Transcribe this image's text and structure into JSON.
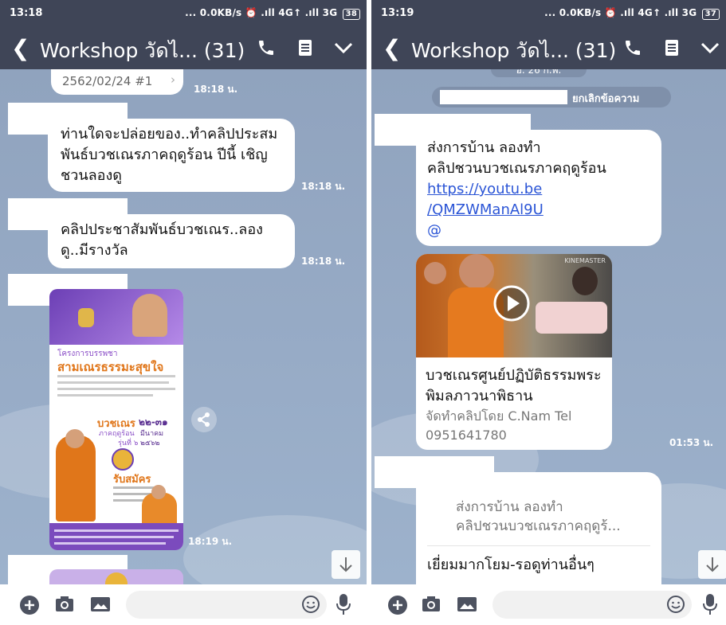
{
  "left": {
    "status": {
      "time": "13:18",
      "right": "... 0.0KB/s ⏰ .ıll 4G↑ .ıll 3G",
      "battery": "38"
    },
    "header": {
      "title": "Workshop วัดไ... (31)"
    },
    "messages": {
      "top_pill": "2562/02/24 #1",
      "top_time": "18:18 น.",
      "msg1_text": "ท่านใดจะปล่อยของ..ทำคลิปประสมพันธ์บวชเณรภาคฤดูร้อน ปีนี้ เชิญชวนลองดู",
      "msg1_time": "18:18 น.",
      "msg2_text": "คลิปประชาสัมพันธ์บวชเณร..ลองดู..มีรางวัล",
      "msg2_time": "18:18 น.",
      "poster": {
        "heading1": "โครงการบรรพชา",
        "heading2": "สามเณรธรรมะสุขใจ",
        "sub1": "บวชเณร",
        "sub2": "ภาคฤดูร้อน",
        "sub3": "รุ่นที่ ๖",
        "dates": "๒๒-๓๑",
        "month": "มีนาคม",
        "year": "๒๕๖๒",
        "apply": "รับสมัคร"
      },
      "image_time": "18:19 น."
    }
  },
  "right": {
    "status": {
      "time": "13:19",
      "right": "... 0.0KB/s ⏰ .ıll 4G↑ .ıll 3G",
      "battery": "37"
    },
    "header": {
      "title": "Workshop วัดไ... (31)"
    },
    "messages": {
      "date_pill": "อ. 26 ก.พ.",
      "unsend_text": "ยกเลิกข้อความ",
      "msg1_line1": "ส่งการบ้าน ลองทำ",
      "msg1_line2": "คลิปชวนบวชเณรภาคฤดูร้อน",
      "msg1_link1": "https://youtu.be",
      "msg1_link2": "/QMZWManAl9U",
      "msg1_at": "@",
      "video": {
        "brand": "KINEMASTER",
        "title": "บวชเณรศูนย์ปฏิบัติธรรมพระพิมลภาวนาพิธาน",
        "desc": "จัดทำคลิปโดย C.Nam Tel 0951641780"
      },
      "video_time": "01:53 น.",
      "reply_quote_line1": "ส่งการบ้าน ลองทำ",
      "reply_quote_line2": "คลิปชวนบวชเณรภาคฤดูร้...",
      "reply_text": "เยี่ยมมากโยม-รอดูท่านอื่นๆ"
    }
  },
  "colors": {
    "bar": "#3f4557",
    "chat_bg": "#97abc6",
    "link": "#2b55d6",
    "purple": "#8b5fc7",
    "orange": "#e0761a"
  }
}
